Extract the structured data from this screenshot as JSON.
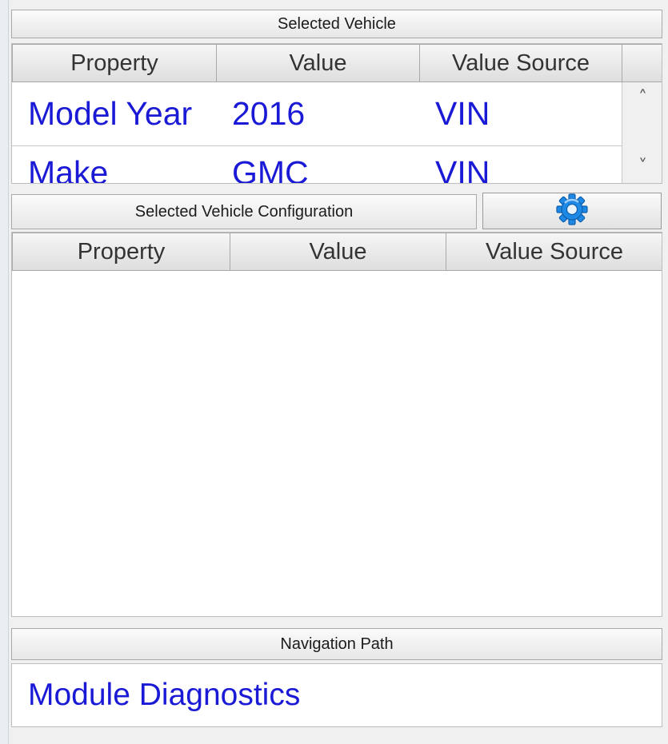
{
  "selected_vehicle": {
    "title": "Selected Vehicle",
    "columns": [
      "Property",
      "Value",
      "Value Source"
    ],
    "rows": [
      [
        "Model Year",
        "2016",
        "VIN"
      ],
      [
        "Make",
        "GMC",
        "VIN"
      ]
    ],
    "scroll_up_glyph": "˄",
    "scroll_down_glyph": "˅"
  },
  "vehicle_configuration": {
    "title": "Selected Vehicle Configuration",
    "settings_icon": "gear-icon",
    "columns": [
      "Property",
      "Value",
      "Value Source"
    ]
  },
  "navigation": {
    "title": "Navigation Path",
    "path": "Module Diagnostics"
  },
  "colors": {
    "link_text": "#1a1ad6",
    "gear_blue": "#1e88e5"
  }
}
